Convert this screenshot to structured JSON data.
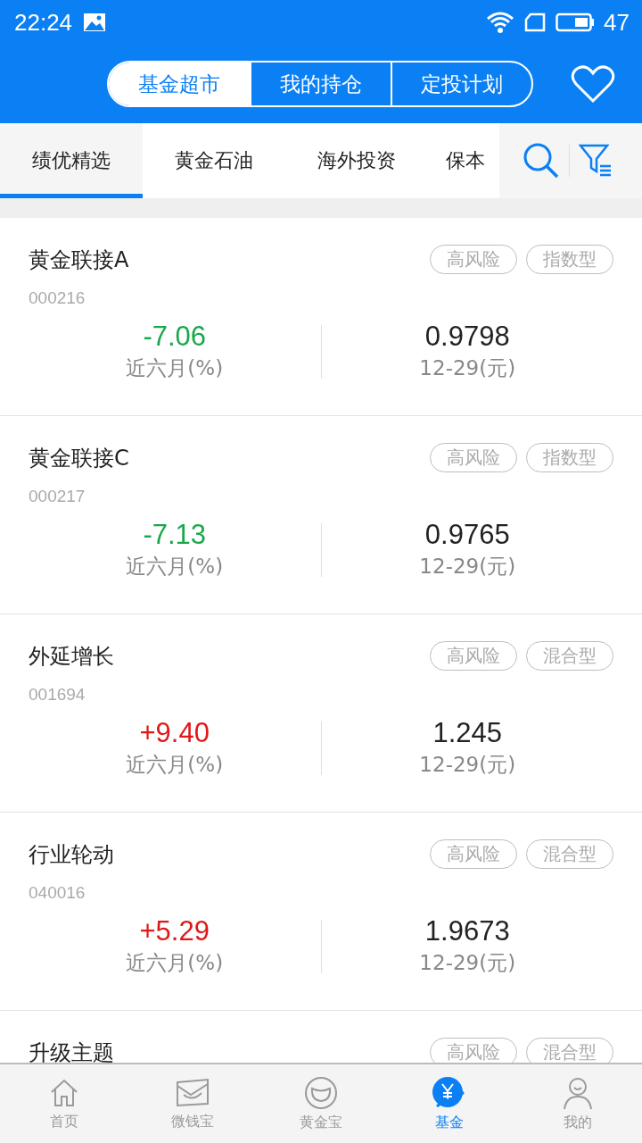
{
  "status_bar": {
    "time": "22:24",
    "battery": "47"
  },
  "segments": [
    {
      "label": "基金超市",
      "selected": true
    },
    {
      "label": "我的持仓",
      "selected": false
    },
    {
      "label": "定投计划",
      "selected": false
    }
  ],
  "categories": [
    {
      "label": "绩优精选",
      "selected": true
    },
    {
      "label": "黄金石油",
      "selected": false
    },
    {
      "label": "海外投资",
      "selected": false
    },
    {
      "label": "保本",
      "selected": false
    }
  ],
  "funds": [
    {
      "name": "黄金联接A",
      "code": "000216",
      "tags": [
        "高风险",
        "指数型"
      ],
      "change": "-7.06",
      "color": "#1aa84a",
      "change_label": "近六月(%)",
      "nav": "0.9798",
      "nav_label": "12-29(元)"
    },
    {
      "name": "黄金联接C",
      "code": "000217",
      "tags": [
        "高风险",
        "指数型"
      ],
      "change": "-7.13",
      "color": "#1aa84a",
      "change_label": "近六月(%)",
      "nav": "0.9765",
      "nav_label": "12-29(元)"
    },
    {
      "name": "外延增长",
      "code": "001694",
      "tags": [
        "高风险",
        "混合型"
      ],
      "change": "+9.40",
      "color": "#e01818",
      "change_label": "近六月(%)",
      "nav": "1.245",
      "nav_label": "12-29(元)"
    },
    {
      "name": "行业轮动",
      "code": "040016",
      "tags": [
        "高风险",
        "混合型"
      ],
      "change": "+5.29",
      "color": "#e01818",
      "change_label": "近六月(%)",
      "nav": "1.9673",
      "nav_label": "12-29(元)"
    },
    {
      "name": "升级主题",
      "tags": [
        "高风险",
        "混合型"
      ]
    }
  ],
  "bottom_nav": [
    {
      "label": "首页",
      "kind": "home",
      "selected": false
    },
    {
      "label": "微钱宝",
      "kind": "envelope",
      "selected": false
    },
    {
      "label": "黄金宝",
      "kind": "ingot",
      "selected": false
    },
    {
      "label": "基金",
      "kind": "fund",
      "selected": true
    },
    {
      "label": "我的",
      "kind": "person",
      "selected": false
    }
  ]
}
